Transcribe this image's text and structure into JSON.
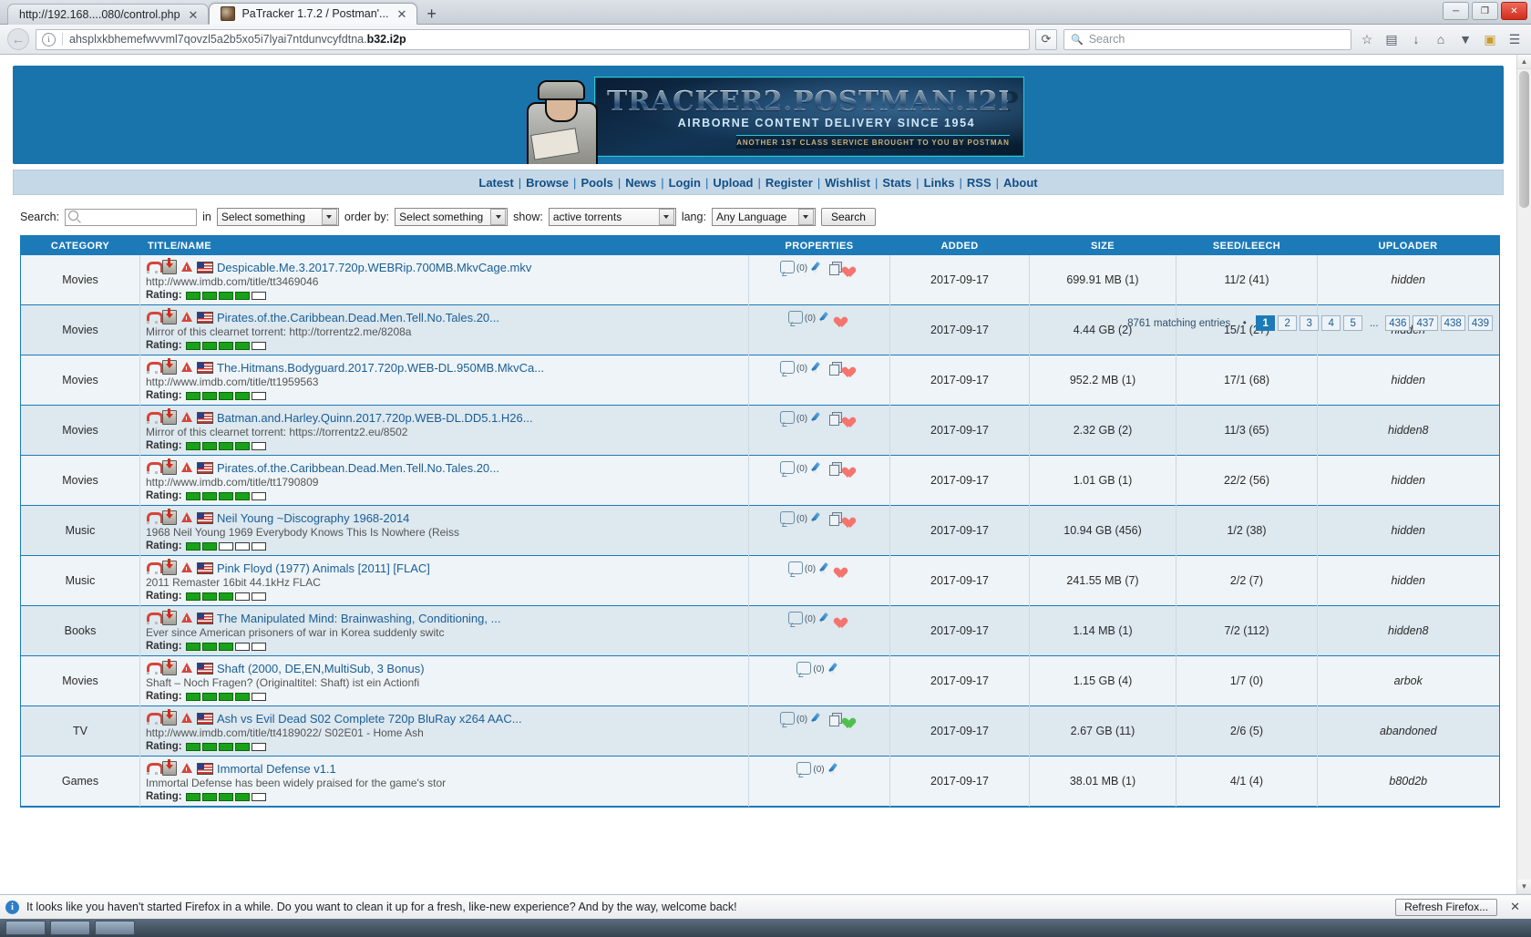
{
  "browser": {
    "tabs": [
      {
        "title": "http://192.168....080/control.php",
        "active": false,
        "close": "✕"
      },
      {
        "title": "PaTracker 1.7.2 / Postman'...",
        "active": true,
        "close": "✕"
      }
    ],
    "newtab_label": "+",
    "window_controls": {
      "minimize": "─",
      "maximize": "❐",
      "close": "✕"
    },
    "nav": {
      "back": "←",
      "info": "i",
      "url_main": "ahsplxkbhemefwvvml7qovzl5a2b5xo5i7lyai7ntdunvcyfdtna.",
      "url_suffix": "b32.i2p",
      "reload": "⟳",
      "search_placeholder": "Search",
      "search_icon": "🔍",
      "bookmark_icon": "☆",
      "library_icon": "▤",
      "downloads_icon": "↓",
      "home_icon": "⌂",
      "pocket_icon": "▼",
      "account_icon": "▣",
      "menu_icon": "☰"
    }
  },
  "site": {
    "banner": {
      "title": "TRACKER2.POSTMAN.I2P",
      "subtitle": "AIRBORNE CONTENT DELIVERY SINCE 1954",
      "strip": "ANOTHER 1ST CLASS SERVICE BROUGHT TO YOU BY POSTMAN"
    },
    "nav_links": [
      "Latest",
      "Browse",
      "Pools",
      "News",
      "Login",
      "Upload",
      "Register",
      "Wishlist",
      "Stats",
      "Links",
      "RSS",
      "About"
    ],
    "nav_separator": "|"
  },
  "searchbar": {
    "label_search": "Search:",
    "query_value": "",
    "label_in": "in",
    "select_in": "Select something",
    "label_orderby": "order by:",
    "select_orderby": "Select something",
    "label_show": "show:",
    "select_show": "active torrents",
    "label_lang": "lang:",
    "select_lang": "Any Language",
    "button": "Search"
  },
  "pagination": {
    "summary": "8761 matching entries",
    "bullet": "•",
    "pages": [
      "1",
      "2",
      "3",
      "4",
      "5"
    ],
    "ellipsis": "...",
    "tail_pages": [
      "436",
      "437",
      "438",
      "439"
    ],
    "current": "1"
  },
  "table": {
    "headers": [
      "CATEGORY",
      "TITLE/NAME",
      "PROPERTIES",
      "ADDED",
      "SIZE",
      "SEED/LEECH",
      "UPLOADER"
    ],
    "rows": [
      {
        "category": "Movies",
        "title": "Despicable.Me.3.2017.720p.WEBRip.700MB.MkvCage.mkv",
        "desc": "http://www.imdb.com/title/tt3469046",
        "rating": 4,
        "rating_label": "Rating:",
        "comments": "(0)",
        "added": "2017-09-17",
        "size": "699.91 MB (1)",
        "seedleech": "11/2 (41)",
        "uploader": "hidden",
        "uploader_style": "italic",
        "icons": [
          "magnet",
          "download",
          "warning",
          "flag-us"
        ],
        "prop_icons": [
          "comment",
          "pen",
          "stack",
          "heart"
        ]
      },
      {
        "category": "Movies",
        "title": "Pirates.of.the.Caribbean.Dead.Men.Tell.No.Tales.20...",
        "desc": "Mirror of this clearnet torrent: http://torrentz2.me/8208a",
        "rating": 4,
        "rating_label": "Rating:",
        "comments": "(0)",
        "added": "2017-09-17",
        "size": "4.44 GB (2)",
        "seedleech": "15/1 (27)",
        "uploader": "hidden",
        "uploader_style": "italic",
        "icons": [
          "magnet",
          "download",
          "warning",
          "flag-us"
        ],
        "prop_icons": [
          "comment",
          "pen",
          "heart"
        ]
      },
      {
        "category": "Movies",
        "title": "The.Hitmans.Bodyguard.2017.720p.WEB-DL.950MB.MkvCa...",
        "desc": "http://www.imdb.com/title/tt1959563",
        "rating": 4,
        "rating_label": "Rating:",
        "comments": "(0)",
        "added": "2017-09-17",
        "size": "952.2 MB (1)",
        "seedleech": "17/1 (68)",
        "uploader": "hidden",
        "uploader_style": "italic",
        "icons": [
          "magnet",
          "download",
          "warning",
          "flag-us"
        ],
        "prop_icons": [
          "comment",
          "pen",
          "stack",
          "heart"
        ]
      },
      {
        "category": "Movies",
        "title": "Batman.and.Harley.Quinn.2017.720p.WEB-DL.DD5.1.H26...",
        "desc": "Mirror of this clearnet torrent: https://torrentz2.eu/8502",
        "rating": 4,
        "rating_label": "Rating:",
        "comments": "(0)",
        "added": "2017-09-17",
        "size": "2.32 GB (2)",
        "seedleech": "11/3 (65)",
        "uploader": "hidden8",
        "uploader_style": "normal",
        "icons": [
          "magnet",
          "download",
          "warning",
          "flag-us"
        ],
        "prop_icons": [
          "comment",
          "pen",
          "stack",
          "heart"
        ]
      },
      {
        "category": "Movies",
        "title": "Pirates.of.the.Caribbean.Dead.Men.Tell.No.Tales.20...",
        "desc": "http://www.imdb.com/title/tt1790809",
        "rating": 4,
        "rating_label": "Rating:",
        "comments": "(0)",
        "added": "2017-09-17",
        "size": "1.01 GB (1)",
        "seedleech": "22/2 (56)",
        "uploader": "hidden",
        "uploader_style": "italic",
        "icons": [
          "magnet",
          "download",
          "warning",
          "flag-us"
        ],
        "prop_icons": [
          "comment",
          "pen",
          "stack",
          "heart"
        ]
      },
      {
        "category": "Music",
        "title": "Neil Young ~Discography 1968-2014",
        "desc": "1968 Neil Young 1969 Everybody Knows This Is Nowhere (Reiss",
        "rating": 2,
        "rating_label": "Rating:",
        "comments": "(0)",
        "added": "2017-09-17",
        "size": "10.94 GB (456)",
        "seedleech": "1/2 (38)",
        "uploader": "hidden",
        "uploader_style": "italic",
        "icons": [
          "magnet",
          "download",
          "warning",
          "flag-us"
        ],
        "prop_icons": [
          "comment",
          "pen",
          "stack",
          "heart"
        ]
      },
      {
        "category": "Music",
        "title": "Pink Floyd (1977) Animals [2011] [FLAC]",
        "desc": "2011 Remaster 16bit 44.1kHz FLAC",
        "rating": 3,
        "rating_label": "Rating:",
        "comments": "(0)",
        "added": "2017-09-17",
        "size": "241.55 MB (7)",
        "seedleech": "2/2 (7)",
        "uploader": "hidden",
        "uploader_style": "italic",
        "icons": [
          "magnet",
          "download",
          "warning",
          "flag-us"
        ],
        "prop_icons": [
          "comment",
          "pen",
          "heart"
        ]
      },
      {
        "category": "Books",
        "title": "The Manipulated Mind: Brainwashing, Conditioning, ...",
        "desc": "Ever since American prisoners of war in Korea suddenly switc",
        "rating": 3,
        "rating_label": "Rating:",
        "comments": "(0)",
        "added": "2017-09-17",
        "size": "1.14 MB (1)",
        "seedleech": "7/2 (112)",
        "uploader": "hidden8",
        "uploader_style": "normal",
        "icons": [
          "magnet",
          "download",
          "warning",
          "flag-us"
        ],
        "prop_icons": [
          "comment",
          "pen",
          "heart"
        ]
      },
      {
        "category": "Movies",
        "title": "Shaft (2000, DE,EN,MultiSub, 3 Bonus)",
        "desc": "Shaft – Noch Fragen? (Originaltitel: Shaft) ist ein Actionfi",
        "rating": 4,
        "rating_label": "Rating:",
        "comments": "(0)",
        "added": "2017-09-17",
        "size": "1.15 GB (4)",
        "seedleech": "1/7 (0)",
        "uploader": "arbok",
        "uploader_style": "normal",
        "icons": [
          "magnet",
          "download",
          "warning",
          "flag-us"
        ],
        "prop_icons": [
          "comment",
          "pen"
        ]
      },
      {
        "category": "TV",
        "title": "Ash vs Evil Dead S02 Complete 720p BluRay x264 AAC...",
        "desc": "http://www.imdb.com/title/tt4189022/ S02E01 - Home Ash",
        "rating": 4,
        "rating_label": "Rating:",
        "comments": "(0)",
        "added": "2017-09-17",
        "size": "2.67 GB (11)",
        "seedleech": "2/6 (5)",
        "uploader": "abandoned",
        "uploader_style": "abandoned",
        "icons": [
          "magnet",
          "download",
          "warning",
          "flag-us"
        ],
        "prop_icons": [
          "comment",
          "pen",
          "stack",
          "heart-green"
        ]
      },
      {
        "category": "Games",
        "title": "Immortal Defense v1.1",
        "desc": "Immortal Defense has been widely praised for the game's stor",
        "rating": 4,
        "rating_label": "Rating:",
        "comments": "(0)",
        "added": "2017-09-17",
        "size": "38.01 MB (1)",
        "seedleech": "4/1 (4)",
        "uploader": "b80d2b",
        "uploader_style": "normal",
        "icons": [
          "magnet",
          "download",
          "warning",
          "flag-us"
        ],
        "prop_icons": [
          "comment",
          "pen"
        ]
      }
    ]
  },
  "notification": {
    "icon": "i",
    "message": "It looks like you haven't started Firefox in a while. Do you want to clean it up for a fresh, like-new experience? And by the way, welcome back!",
    "button": "Refresh Firefox...",
    "close": "✕"
  }
}
